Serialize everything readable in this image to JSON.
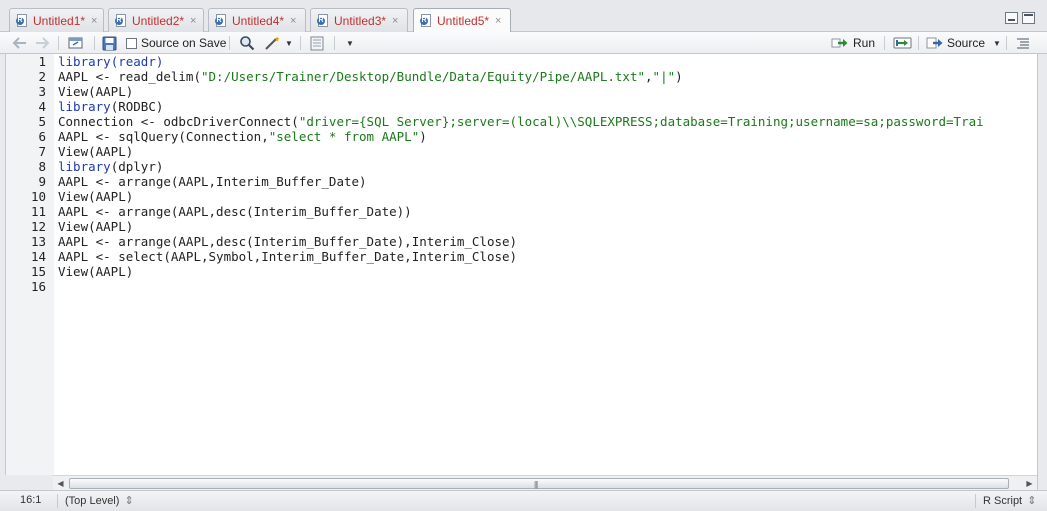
{
  "tabs": [
    {
      "label": "Untitled1*",
      "close": "×"
    },
    {
      "label": "Untitled2*",
      "close": "×"
    },
    {
      "label": "Untitled4*",
      "close": "×"
    },
    {
      "label": "Untitled3*",
      "close": "×"
    },
    {
      "label": "Untitled5*",
      "close": "×",
      "active": true
    }
  ],
  "toolbar": {
    "source_on_save_label": "Source on Save",
    "run_label": "Run",
    "source_label": "Source"
  },
  "editor": {
    "line_numbers": [
      "1",
      "2",
      "3",
      "4",
      "5",
      "6",
      "7",
      "8",
      "9",
      "10",
      "11",
      "12",
      "13",
      "14",
      "15",
      "16"
    ],
    "lines": [
      [
        {
          "t": "library",
          "c": "kw"
        },
        {
          "t": "(readr)",
          "c": "kw"
        }
      ],
      [
        {
          "t": "AAPL <- read_delim(",
          "c": ""
        },
        {
          "t": "\"D:/Users/Trainer/Desktop/Bundle/Data/Equity/Pipe/AAPL.txt\"",
          "c": "str"
        },
        {
          "t": ",",
          "c": ""
        },
        {
          "t": "\"|\"",
          "c": "str"
        },
        {
          "t": ")",
          "c": ""
        }
      ],
      [
        {
          "t": "View(AAPL)",
          "c": ""
        }
      ],
      [
        {
          "t": "library",
          "c": "kw"
        },
        {
          "t": "(RODBC)",
          "c": ""
        }
      ],
      [
        {
          "t": "Connection <- odbcDriverConnect(",
          "c": ""
        },
        {
          "t": "\"driver={SQL Server};server=(local)\\\\SQLEXPRESS;database=Training;username=sa;password=Trai",
          "c": "str"
        }
      ],
      [
        {
          "t": "AAPL <- sqlQuery(Connection,",
          "c": ""
        },
        {
          "t": "\"select * from AAPL\"",
          "c": "str"
        },
        {
          "t": ")",
          "c": ""
        }
      ],
      [
        {
          "t": "View(AAPL)",
          "c": ""
        }
      ],
      [
        {
          "t": "library",
          "c": "kw"
        },
        {
          "t": "(dplyr)",
          "c": ""
        }
      ],
      [
        {
          "t": "AAPL <- arrange(AAPL,Interim_Buffer_Date)",
          "c": ""
        }
      ],
      [
        {
          "t": "View(AAPL)",
          "c": ""
        }
      ],
      [
        {
          "t": "AAPL <- arrange(AAPL,desc(Interim_Buffer_Date))",
          "c": ""
        }
      ],
      [
        {
          "t": "View(AAPL)",
          "c": ""
        }
      ],
      [
        {
          "t": "AAPL <- arrange(AAPL,desc(Interim_Buffer_Date),Interim_Close)",
          "c": ""
        }
      ],
      [
        {
          "t": "AAPL <- select(AAPL,Symbol,Interim_Buffer_Date,Interim_Close)",
          "c": ""
        }
      ],
      [
        {
          "t": "View(AAPL)",
          "c": ""
        }
      ],
      []
    ]
  },
  "statusbar": {
    "position": "16:1",
    "scope": "(Top Level)",
    "scope_arrows": "⇕",
    "file_type": "R Script",
    "file_type_arrows": "⇕"
  },
  "colors": {
    "keyword": "#1c3ab5",
    "string": "#1a7a1a",
    "tab_label": "#c03030"
  }
}
